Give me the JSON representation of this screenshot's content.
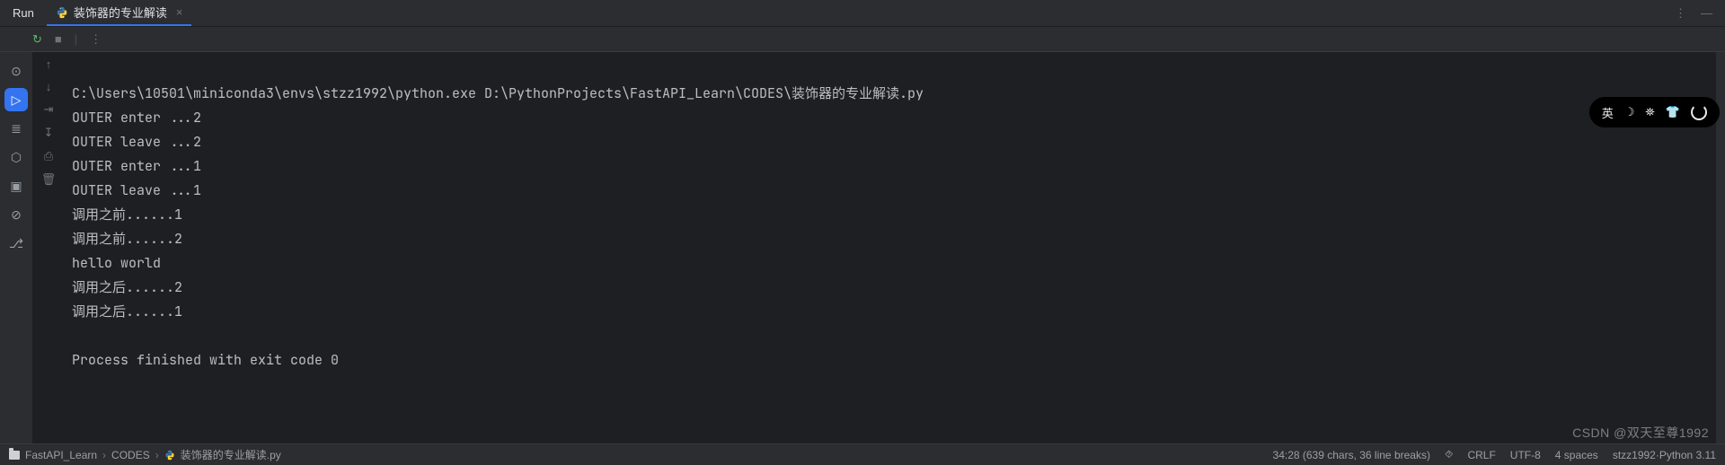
{
  "header": {
    "run_label": "Run",
    "tab": {
      "filename": "装饰器的专业解读",
      "close": "×"
    },
    "right": {
      "more": "⋮",
      "minimize": "—"
    }
  },
  "toolbar2": {
    "rerun": "↻",
    "stop": "■",
    "sep": "|",
    "more": "⋮"
  },
  "left_rail": {
    "python": "⊙",
    "play": "▷",
    "stack": "≣",
    "debug": "⬡",
    "terminal": "▣",
    "problems": "⊘",
    "git": "⎇"
  },
  "gutter": {
    "up": "↑",
    "down": "↓",
    "wrap": "⇥",
    "scroll": "↧",
    "print": "⎙",
    "trash": "🗑"
  },
  "console_lines": [
    "C:\\Users\\10501\\miniconda3\\envs\\stzz1992\\python.exe D:\\PythonProjects\\FastAPI_Learn\\CODES\\装饰器的专业解读.py",
    "OUTER enter ...2",
    "OUTER leave ...2",
    "OUTER enter ...1",
    "OUTER leave ...1",
    "调用之前......1",
    "调用之前......2",
    "hello world",
    "调用之后......2",
    "调用之后......1",
    "",
    "Process finished with exit code 0"
  ],
  "breadcrumbs": {
    "project": "FastAPI_Learn",
    "folder": "CODES",
    "file": "装饰器的专业解读.py",
    "sep": "›"
  },
  "status": {
    "position": "34:28 (639 chars, 36 line breaks)",
    "lock": "⯑",
    "line_ending": "CRLF",
    "encoding": "UTF-8",
    "indent": "4 spaces",
    "interpreter": "stzz1992·Python 3.11"
  },
  "watermark": "CSDN @双天至尊1992",
  "ime": {
    "lang": "英",
    "moon": "☽",
    "person": "⛯",
    "shirt": "👕"
  }
}
